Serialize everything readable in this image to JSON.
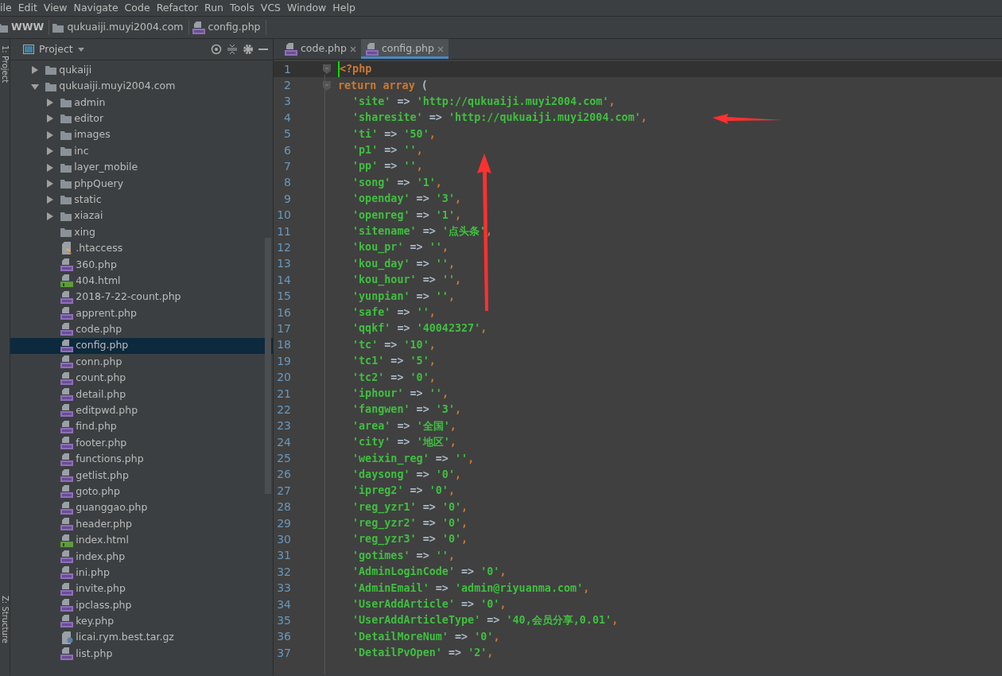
{
  "menu": [
    "ile",
    "Edit",
    "View",
    "Navigate",
    "Code",
    "Refactor",
    "Run",
    "Tools",
    "VCS",
    "Window",
    "Help"
  ],
  "breadcrumbs": [
    {
      "label": "WWW",
      "kind": "folder"
    },
    {
      "label": "qukuaiji.muyi2004.com",
      "kind": "folder"
    },
    {
      "label": "config.php",
      "kind": "php"
    }
  ],
  "tool_strip": [
    "1: Project",
    "Z: Structure"
  ],
  "project": {
    "title": "Project",
    "tree": [
      {
        "label": "qukaiji",
        "kind": "folder",
        "expanded": false,
        "selected": false
      },
      {
        "label": "qukuaiji.muyi2004.com",
        "kind": "folder",
        "expanded": true,
        "selected": false,
        "children": [
          {
            "label": "admin",
            "kind": "folder",
            "expanded": false,
            "selected": false
          },
          {
            "label": "editor",
            "kind": "folder",
            "expanded": false,
            "selected": false
          },
          {
            "label": "images",
            "kind": "folder",
            "expanded": false,
            "selected": false
          },
          {
            "label": "inc",
            "kind": "folder",
            "expanded": false,
            "selected": false
          },
          {
            "label": "layer_mobile",
            "kind": "folder",
            "expanded": false,
            "selected": false
          },
          {
            "label": "phpQuery",
            "kind": "folder",
            "expanded": false,
            "selected": false
          },
          {
            "label": "static",
            "kind": "folder",
            "expanded": false,
            "selected": false
          },
          {
            "label": "xiazai",
            "kind": "folder",
            "expanded": false,
            "selected": false
          },
          {
            "label": "xing",
            "kind": "empty_folder",
            "selected": false
          },
          {
            "label": ".htaccess",
            "kind": "htaccess",
            "selected": false
          },
          {
            "label": "360.php",
            "kind": "php",
            "selected": false
          },
          {
            "label": "404.html",
            "kind": "html",
            "selected": false
          },
          {
            "label": "2018-7-22-count.php",
            "kind": "php",
            "selected": false
          },
          {
            "label": "apprent.php",
            "kind": "php",
            "selected": false
          },
          {
            "label": "code.php",
            "kind": "php",
            "selected": false
          },
          {
            "label": "config.php",
            "kind": "php",
            "selected": true
          },
          {
            "label": "conn.php",
            "kind": "php",
            "selected": false
          },
          {
            "label": "count.php",
            "kind": "php",
            "selected": false
          },
          {
            "label": "detail.php",
            "kind": "php",
            "selected": false
          },
          {
            "label": "editpwd.php",
            "kind": "php",
            "selected": false
          },
          {
            "label": "find.php",
            "kind": "php",
            "selected": false
          },
          {
            "label": "footer.php",
            "kind": "php",
            "selected": false
          },
          {
            "label": "functions.php",
            "kind": "php",
            "selected": false
          },
          {
            "label": "getlist.php",
            "kind": "php",
            "selected": false
          },
          {
            "label": "goto.php",
            "kind": "php",
            "selected": false
          },
          {
            "label": "guanggao.php",
            "kind": "php",
            "selected": false
          },
          {
            "label": "header.php",
            "kind": "php",
            "selected": false
          },
          {
            "label": "index.html",
            "kind": "html",
            "selected": false
          },
          {
            "label": "index.php",
            "kind": "php",
            "selected": false
          },
          {
            "label": "ini.php",
            "kind": "php",
            "selected": false
          },
          {
            "label": "invite.php",
            "kind": "php",
            "selected": false
          },
          {
            "label": "ipclass.php",
            "kind": "php",
            "selected": false
          },
          {
            "label": "key.php",
            "kind": "php",
            "selected": false
          },
          {
            "label": "licai.rym.best.tar.gz",
            "kind": "archive",
            "selected": false
          },
          {
            "label": "list.php",
            "kind": "php",
            "selected": false
          }
        ]
      }
    ]
  },
  "tabs": [
    {
      "label": "code.php",
      "selected": false
    },
    {
      "label": "config.php",
      "selected": true
    }
  ],
  "editor": {
    "lines": [
      {
        "number": "1",
        "text": "<?php",
        "current": true
      },
      {
        "number": "2",
        "text": "return array ("
      },
      {
        "number": "3",
        "text": "'site' => 'http://qukuaiji.muyi2004.com',"
      },
      {
        "number": "4",
        "text": "'sharesite' => 'http://qukuaiji.muyi2004.com',"
      },
      {
        "number": "5",
        "text": "'ti' => '50',"
      },
      {
        "number": "6",
        "text": "'p1' => '',"
      },
      {
        "number": "7",
        "text": "'pp' => '',"
      },
      {
        "number": "8",
        "text": "'song' => '1',"
      },
      {
        "number": "9",
        "text": "'openday' => '3',"
      },
      {
        "number": "10",
        "text": "'openreg' => '1',"
      },
      {
        "number": "11",
        "text": "'sitename' => '点头条',"
      },
      {
        "number": "12",
        "text": "'kou_pr' => '',"
      },
      {
        "number": "13",
        "text": "'kou_day' => '',"
      },
      {
        "number": "14",
        "text": "'kou_hour' => '',"
      },
      {
        "number": "15",
        "text": "'yunpian' => '',"
      },
      {
        "number": "16",
        "text": "'safe' => '',"
      },
      {
        "number": "17",
        "text": "'qqkf' => '40042327',"
      },
      {
        "number": "18",
        "text": "'tc' => '10',"
      },
      {
        "number": "19",
        "text": "'tc1' => '5',"
      },
      {
        "number": "20",
        "text": "'tc2' => '0',"
      },
      {
        "number": "21",
        "text": "'iphour' => '',"
      },
      {
        "number": "22",
        "text": "'fangwen' => '3',"
      },
      {
        "number": "23",
        "text": "'area' => '全国',"
      },
      {
        "number": "24",
        "text": "'city' => '地区',"
      },
      {
        "number": "25",
        "text": "'weixin_reg' => '',"
      },
      {
        "number": "26",
        "text": "'daysong' => '0',"
      },
      {
        "number": "27",
        "text": "'ipreg2' => '0',"
      },
      {
        "number": "28",
        "text": "'reg_yzr1' => '0',"
      },
      {
        "number": "29",
        "text": "'reg_yzr2' => '0',"
      },
      {
        "number": "30",
        "text": "'reg_yzr3' => '0',"
      },
      {
        "number": "31",
        "text": "'gotimes' => '',"
      },
      {
        "number": "32",
        "text": "'AdminLoginCode' => '0',"
      },
      {
        "number": "33",
        "text": "'AdminEmail' => 'admin@riyuanma.com',"
      },
      {
        "number": "34",
        "text": "'UserAddArticle' => '0',"
      },
      {
        "number": "35",
        "text": "'UserAddArticleType' => '40,会员分享,0.01',"
      },
      {
        "number": "36",
        "text": "'DetailMoreNum' => '0',"
      },
      {
        "number": "37",
        "text": "'DetailPvOpen' => '2',"
      }
    ]
  }
}
